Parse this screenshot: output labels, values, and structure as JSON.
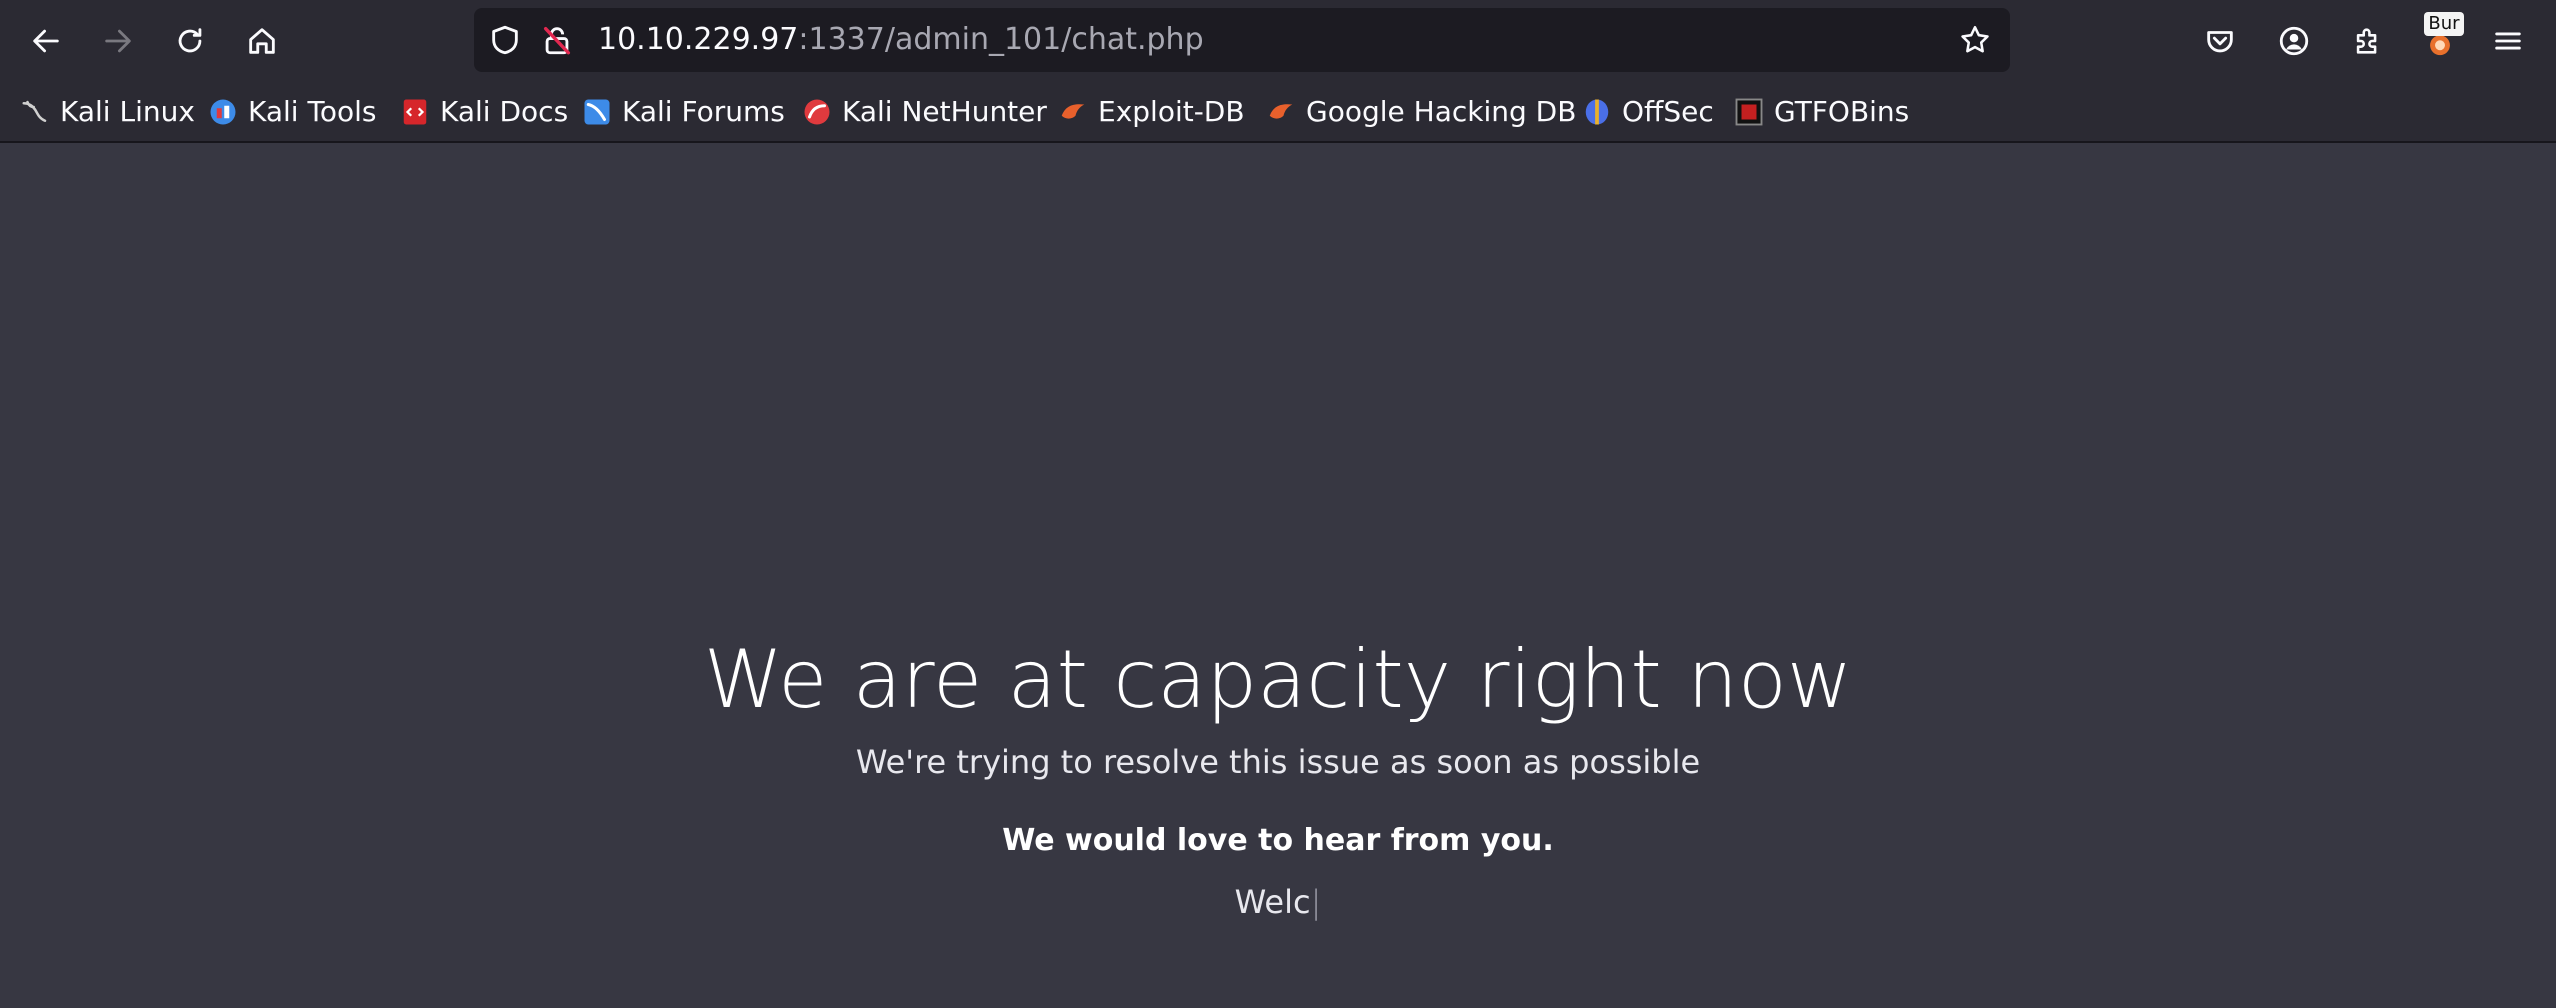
{
  "browser": {
    "url_host": "10.10.229.97",
    "url_rest": ":1337/admin_101/chat.php",
    "extension_badge": "Bur"
  },
  "bookmarks": [
    {
      "label": "Kali Linux",
      "icon": "kali-dragon-icon",
      "color": "#cccccc"
    },
    {
      "label": "Kali Tools",
      "icon": "kali-tools-icon",
      "color": "#3d8be8"
    },
    {
      "label": "Kali Docs",
      "icon": "kali-docs-icon",
      "color": "#d6262b"
    },
    {
      "label": "Kali Forums",
      "icon": "kali-forums-icon",
      "color": "#3d8be8"
    },
    {
      "label": "Kali NetHunter",
      "icon": "kali-nethunter-icon",
      "color": "#e03a3e"
    },
    {
      "label": "Exploit-DB",
      "icon": "exploit-db-icon",
      "color": "#e8602c"
    },
    {
      "label": "Google Hacking DB",
      "icon": "ghdb-icon",
      "color": "#e8602c"
    },
    {
      "label": "OffSec",
      "icon": "offsec-icon",
      "color": "#4a6fe8"
    },
    {
      "label": "GTFOBins",
      "icon": "gtfobins-icon",
      "color": "#c42020"
    }
  ],
  "page": {
    "headline": "We are at capacity right now",
    "subline": "We're trying to resolve this issue as soon as possible",
    "love": "We would love to hear from you.",
    "typed_text": "Welc",
    "cursor": "|"
  }
}
